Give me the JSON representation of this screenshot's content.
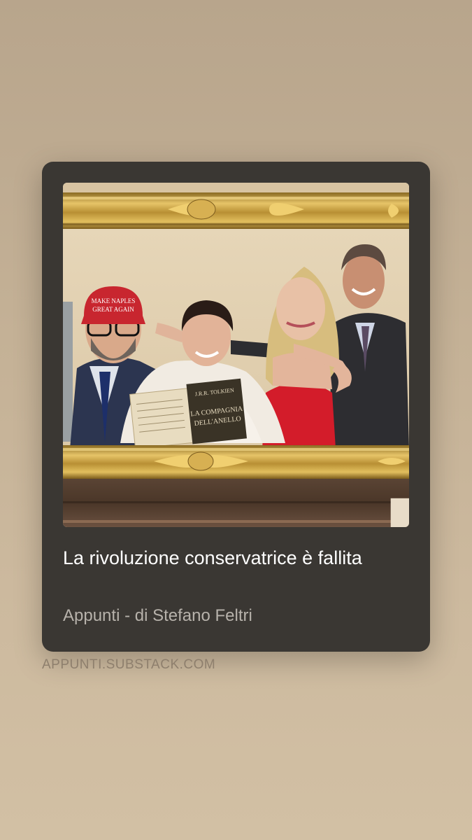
{
  "card": {
    "title": "La rivoluzione conservatrice è fallita",
    "subtitle": "Appunti - di Stefano Feltri",
    "image_alt": "collage-in-gilded-frame",
    "bookmark_icon": "bookmark-icon"
  },
  "link": {
    "domain": "APPUNTI.SUBSTACK.COM"
  },
  "image_text": {
    "cap_line1": "MAKE NAPLES",
    "cap_line2": "GREAT AGAIN",
    "book_author": "J.R.R. TOLKIEN",
    "book_title1": "LA COMPAGNIA",
    "book_title2": "DELL'ANELLO"
  },
  "colors": {
    "card_bg": "#3a3733",
    "title": "#ffffff",
    "subtitle": "#b7b2ab",
    "domain": "#8e7f6d",
    "gold": "#c9a24a"
  }
}
